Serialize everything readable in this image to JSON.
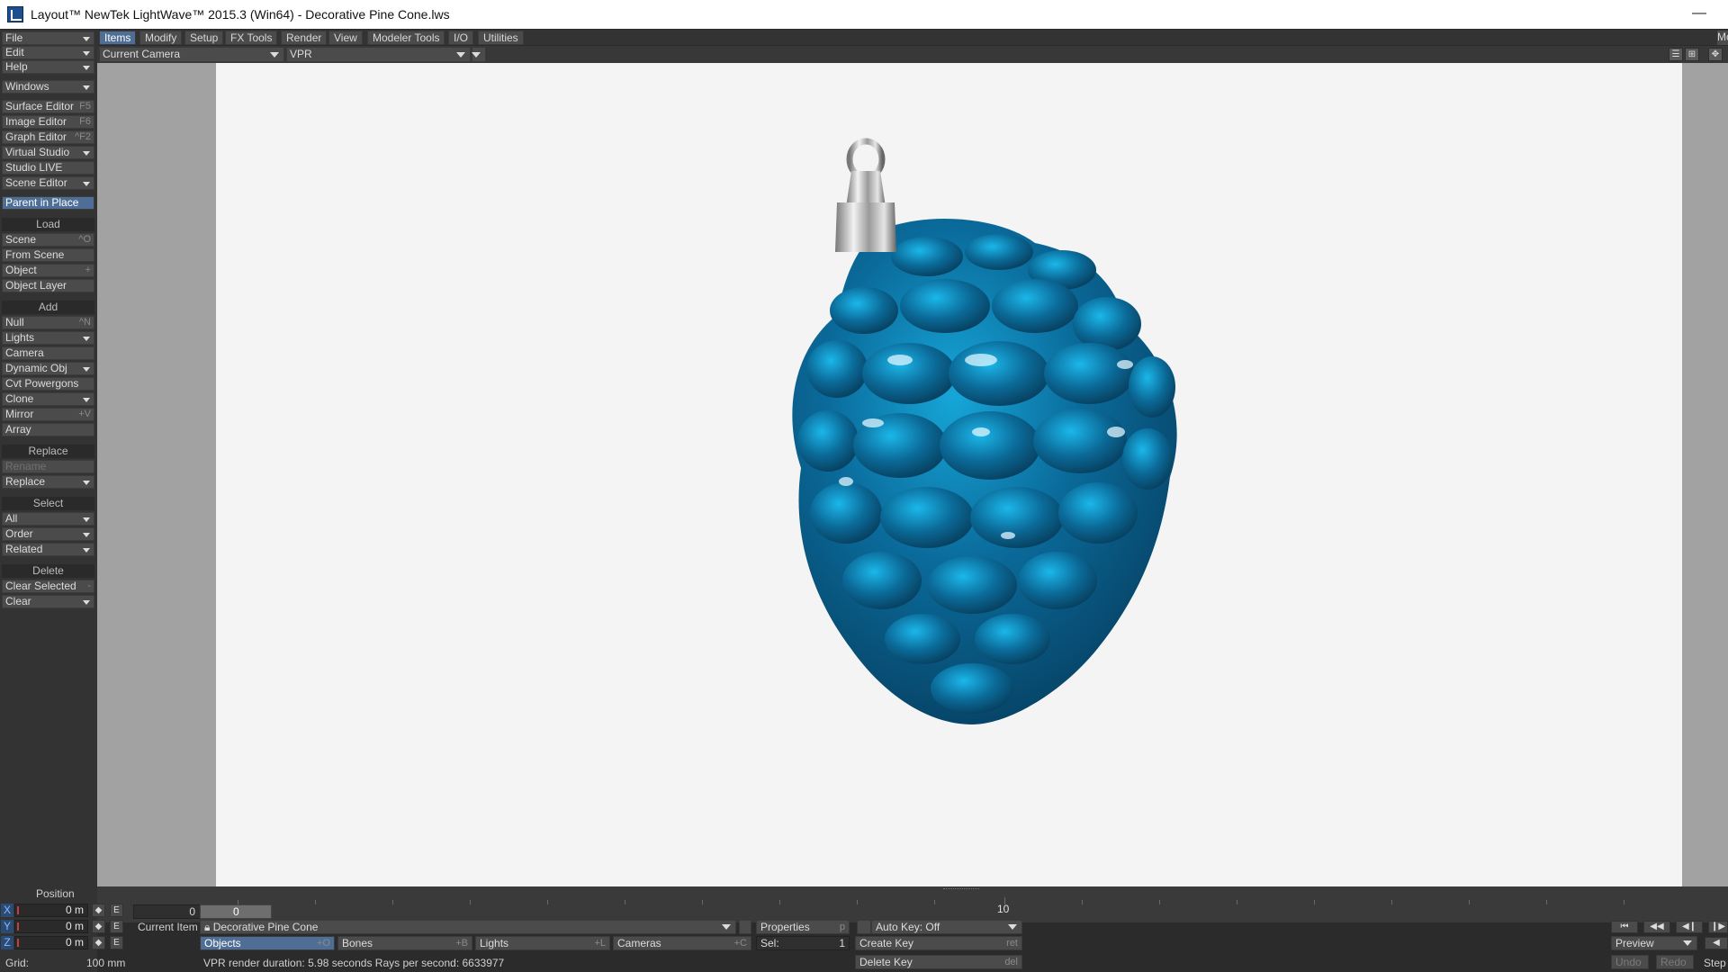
{
  "window": {
    "title": "Layout™ NewTek LightWave™ 2015.3 (Win64) - Decorative Pine Cone.lws",
    "minimize_glyph": "—"
  },
  "left_panel": {
    "top_menus": [
      {
        "label": "File"
      },
      {
        "label": "Edit"
      },
      {
        "label": "Help"
      },
      {
        "label": "Windows"
      }
    ],
    "tools": [
      {
        "label": "Surface Editor",
        "shortcut": "F5"
      },
      {
        "label": "Image Editor",
        "shortcut": "F6"
      },
      {
        "label": "Graph Editor",
        "shortcut": "^F2"
      },
      {
        "label": "Virtual Studio",
        "shortcut": ""
      },
      {
        "label": "Studio LIVE",
        "shortcut": ""
      },
      {
        "label": "Scene Editor",
        "shortcut": ""
      }
    ],
    "parent_in_place": "Parent in Place",
    "load": {
      "heading": "Load",
      "items": [
        {
          "label": "Scene",
          "shortcut": "^O"
        },
        {
          "label": "From Scene",
          "shortcut": ""
        },
        {
          "label": "Object",
          "shortcut": "+"
        },
        {
          "label": "Object Layer",
          "shortcut": ""
        }
      ]
    },
    "add": {
      "heading": "Add",
      "items": [
        {
          "label": "Null",
          "shortcut": "^N"
        },
        {
          "label": "Lights",
          "shortcut": ""
        },
        {
          "label": "Camera",
          "shortcut": ""
        },
        {
          "label": "Dynamic Obj",
          "shortcut": ""
        },
        {
          "label": "Cvt Powergons",
          "shortcut": ""
        },
        {
          "label": "Clone",
          "shortcut": ""
        },
        {
          "label": "Mirror",
          "shortcut": "+V"
        },
        {
          "label": "Array",
          "shortcut": ""
        }
      ]
    },
    "replace": {
      "heading": "Replace",
      "items": [
        {
          "label": "Rename"
        },
        {
          "label": "Replace"
        }
      ]
    },
    "select": {
      "heading": "Select",
      "items": [
        {
          "label": "All"
        },
        {
          "label": "Order"
        },
        {
          "label": "Related"
        }
      ]
    },
    "delete": {
      "heading": "Delete",
      "items": [
        {
          "label": "Clear Selected",
          "shortcut": "-"
        },
        {
          "label": "Clear"
        }
      ]
    }
  },
  "tabs": [
    {
      "label": "Items",
      "active": true
    },
    {
      "label": "Modify"
    },
    {
      "label": "Setup"
    },
    {
      "label": "FX Tools"
    },
    {
      "label": "Render"
    },
    {
      "label": "View"
    },
    {
      "label": "Modeler Tools"
    },
    {
      "label": "I/O"
    },
    {
      "label": "Utilities"
    }
  ],
  "tab_overflow": "Mo",
  "viewport": {
    "camera_select": "Current Camera",
    "mode_select": "VPR",
    "accent_color": "#0a6a9a"
  },
  "timeline": {
    "frame_field": "0",
    "slider_value": "0",
    "mark_10": "10"
  },
  "bottom": {
    "position_label": "Position",
    "coords": [
      {
        "axis": "X",
        "value": "0 m"
      },
      {
        "axis": "Y",
        "value": "0 m"
      },
      {
        "axis": "Z",
        "value": "0 m"
      }
    ],
    "grid_label": "Grid:",
    "grid_value": "100 mm",
    "current_item_label": "Current Item",
    "current_item": "Decorative Pine Cone",
    "properties": {
      "label": "Properties",
      "shortcut": "p"
    },
    "auto_key": "Auto Key: Off",
    "objects": {
      "label": "Objects",
      "shortcut": "+O"
    },
    "bones": {
      "label": "Bones",
      "shortcut": "+B"
    },
    "lights": {
      "label": "Lights",
      "shortcut": "+L"
    },
    "cameras": {
      "label": "Cameras",
      "shortcut": "+C"
    },
    "sel_label": "Sel:",
    "sel_value": "1",
    "create_key": {
      "label": "Create Key",
      "shortcut": "ret"
    },
    "delete_key": {
      "label": "Delete Key",
      "shortcut": "del"
    },
    "status": "VPR render duration: 5.98 seconds  Rays per second: 6633977",
    "preview": "Preview",
    "undo": "Undo",
    "redo": "Redo",
    "step": "Step"
  }
}
